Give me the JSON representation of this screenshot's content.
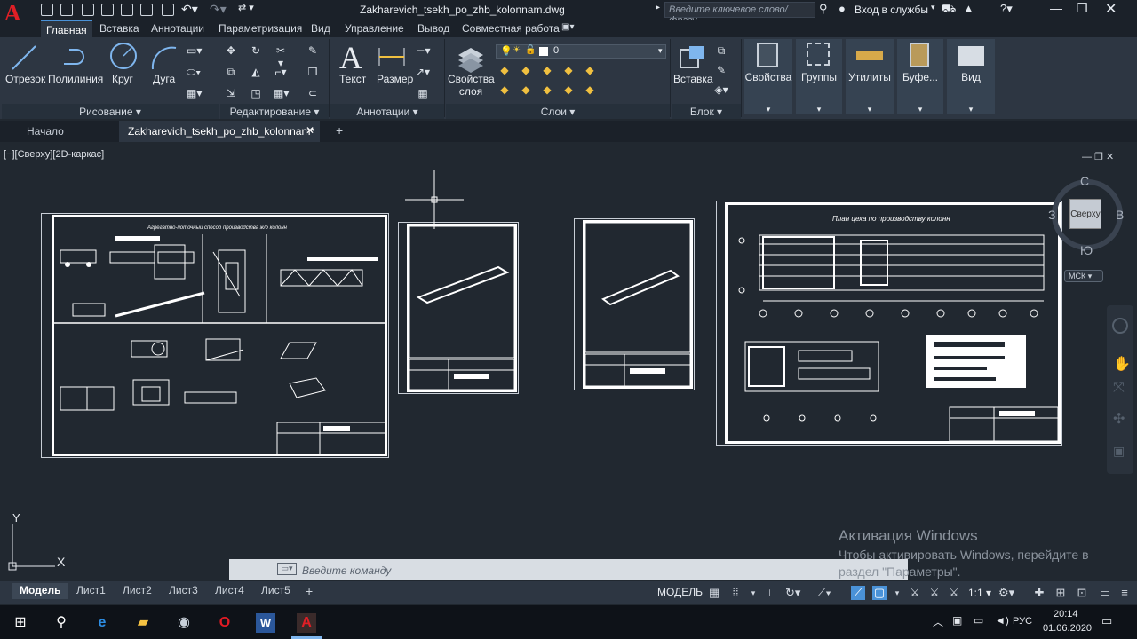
{
  "title_bar": {
    "app_logo": "A",
    "document_title": "Zakharevich_tsekh_po_zhb_kolonnam.dwg",
    "search_placeholder": "Введите ключевое слово/фразу",
    "signin_label": "Вход в службы"
  },
  "ribbon_tabs": [
    "Главная",
    "Вставка",
    "Аннотации",
    "Параметризация",
    "Вид",
    "Управление",
    "Вывод",
    "Совместная работа"
  ],
  "ribbon": {
    "draw": {
      "title": "Рисование",
      "tools": [
        "Отрезок",
        "Полилиния",
        "Круг",
        "Дуга"
      ]
    },
    "modify": {
      "title": "Редактирование"
    },
    "annotation": {
      "title": "Аннотации",
      "tools": [
        "Текст",
        "Размер"
      ]
    },
    "layers": {
      "title": "Слои",
      "properties_label": "Свойства слоя",
      "current_layer": "0"
    },
    "block": {
      "title": "Блок",
      "insert_label": "Вставка"
    },
    "big_buttons": [
      "Свойства",
      "Группы",
      "Утилиты",
      "Буфе...",
      "Вид"
    ]
  },
  "file_tabs": {
    "start": "Начало",
    "active": "Zakharevich_tsekh_po_zhb_kolonnam*"
  },
  "viewport": {
    "label": "[−][Сверху][2D-каркас]"
  },
  "drawings": {
    "sheet1_title": "Агрегатно-поточный способ производства ж/б колонн",
    "sheet4_title": "План цеха по производству колонн"
  },
  "viewcube": {
    "face": "Сверху",
    "north": "С",
    "south": "Ю",
    "east": "В",
    "west": "З",
    "ucs": "МСК"
  },
  "ucs_axes": {
    "x": "X",
    "y": "Y"
  },
  "command_line": {
    "placeholder": "Введите команду"
  },
  "watermark": {
    "title": "Активация Windows",
    "text": "Чтобы активировать Windows, перейдите в раздел \"Параметры\"."
  },
  "layout_tabs": [
    "Модель",
    "Лист1",
    "Лист2",
    "Лист3",
    "Лист4",
    "Лист5"
  ],
  "status": {
    "mode": "МОДЕЛЬ",
    "scale": "1:1"
  },
  "taskbar": {
    "language": "РУС",
    "time": "20:14",
    "date": "01.06.2020"
  },
  "colors": {
    "canvas": "#212830",
    "ribbon": "#2d3642",
    "accent": "#4a92d8",
    "logo": "#e01f26"
  }
}
